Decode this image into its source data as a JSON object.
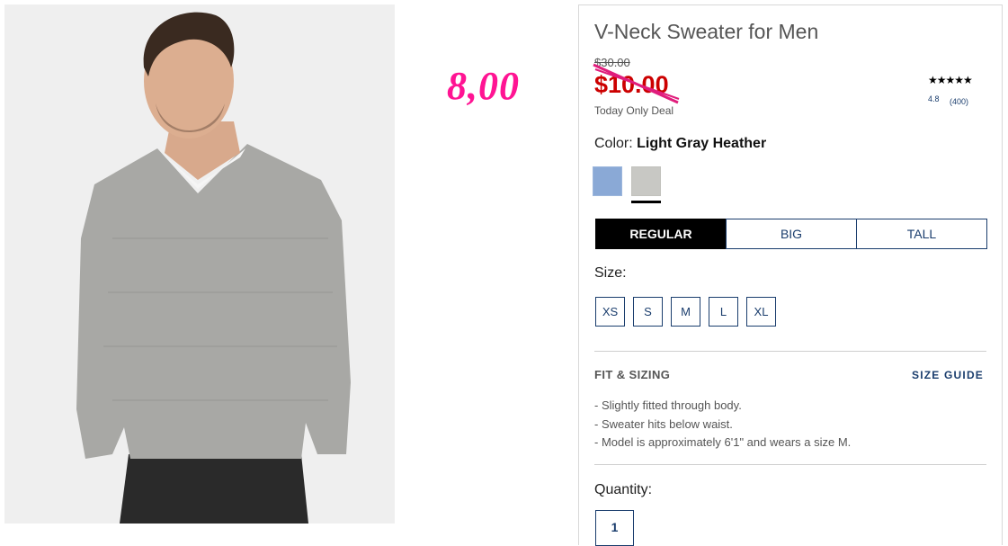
{
  "product": {
    "title": "V-Neck Sweater for Men",
    "old_price": "$30.00",
    "price": "$10.00",
    "deal_label": "Today Only Deal",
    "handwritten_price": "8,00",
    "rating_stars": "★★★★★",
    "rating_value": "4.8",
    "review_count": "(400)"
  },
  "color": {
    "label": "Color:",
    "selected": "Light Gray Heather",
    "swatches": [
      "blue-heather-swatch",
      "light-gray-heather-swatch"
    ]
  },
  "fit_tabs": [
    "REGULAR",
    "BIG",
    "TALL"
  ],
  "size": {
    "label": "Size:",
    "options": [
      "XS",
      "S",
      "M",
      "L",
      "XL"
    ]
  },
  "fit_sizing": {
    "heading": "FIT & SIZING",
    "guide_link": "SIZE GUIDE",
    "bullets": [
      "Slightly fitted through body.",
      "Sweater hits below waist.",
      "Model is approximately 6'1\" and wears a size M."
    ]
  },
  "quantity": {
    "label": "Quantity:",
    "value": "1"
  },
  "colors": {
    "sale_red": "#cc0000",
    "annotation_pink": "#ff1493",
    "navy": "#1a3d6d"
  }
}
